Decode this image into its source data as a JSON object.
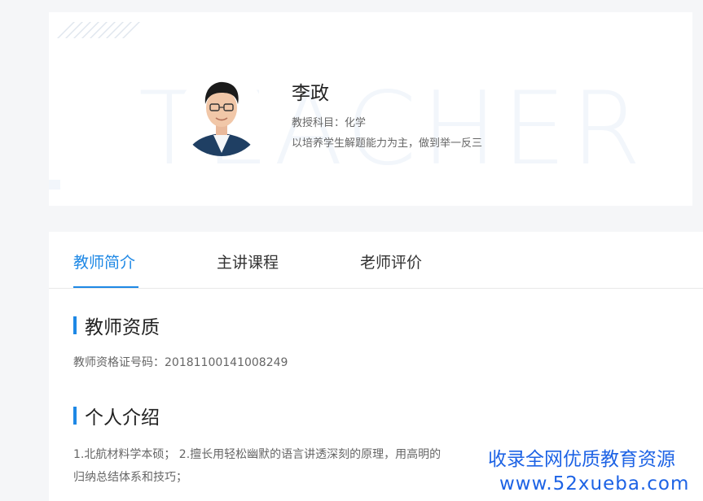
{
  "profile": {
    "watermark": "TEACHER",
    "name": "李政",
    "subject": "教授科目：化学",
    "slogan": "以培养学生解题能力为主，做到举一反三",
    "avatar_icon": "teacher-portrait"
  },
  "tabs": [
    {
      "label": "教师简介",
      "active": true
    },
    {
      "label": "主讲课程",
      "active": false
    },
    {
      "label": "老师评价",
      "active": false
    }
  ],
  "qualification": {
    "title": "教师资质",
    "certificate": "教师资格证号码：20181100141008249"
  },
  "intro": {
    "title": "个人介绍",
    "line1": "1.北航材料学本硕；  2.擅长用轻松幽默的语言讲透深刻的原理，用高明的",
    "line2": "归纳总结体系和技巧；"
  },
  "site_watermark": {
    "line1": "收录全网优质教育资源",
    "line2": "www.52xueba.com"
  },
  "colors": {
    "accent": "#1e88e5",
    "watermark_blue": "#1d63e5"
  }
}
